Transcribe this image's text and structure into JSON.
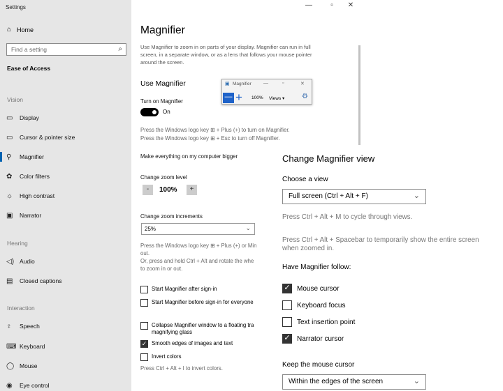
{
  "window": {
    "title": "Settings"
  },
  "sidebar": {
    "home": "Home",
    "search_placeholder": "Find a setting",
    "category": "Ease of Access",
    "sections": {
      "vision": "Vision",
      "hearing": "Hearing",
      "interaction": "Interaction"
    },
    "items": [
      {
        "label": "Display",
        "icon": "monitor-icon"
      },
      {
        "label": "Cursor & pointer size",
        "icon": "pointer-icon"
      },
      {
        "label": "Magnifier",
        "icon": "magnifier-icon"
      },
      {
        "label": "Color filters",
        "icon": "color-filter-icon"
      },
      {
        "label": "High contrast",
        "icon": "contrast-icon"
      },
      {
        "label": "Narrator",
        "icon": "narrator-icon"
      },
      {
        "label": "Audio",
        "icon": "speaker-icon"
      },
      {
        "label": "Closed captions",
        "icon": "captions-icon"
      },
      {
        "label": "Speech",
        "icon": "microphone-icon"
      },
      {
        "label": "Keyboard",
        "icon": "keyboard-icon"
      },
      {
        "label": "Mouse",
        "icon": "mouse-icon"
      },
      {
        "label": "Eye control",
        "icon": "eye-icon"
      }
    ],
    "active_item": "Magnifier"
  },
  "main": {
    "title": "Magnifier",
    "description": "Use Magnifier to zoom in on parts of your display. Magnifier can run in full screen, in a separate window, or as a lens that follows your mouse pointer around the screen.",
    "use_heading": "Use Magnifier",
    "turn_on_label": "Turn on Magnifier",
    "toggle_state": "On",
    "shortcut_on": "Press the Windows logo key ⊞ + Plus (+) to turn on Magnifier.",
    "shortcut_off": "Press the Windows logo key ⊞ + Esc to turn off Magnifier.",
    "bigger_label": "Make everything on my computer bigger",
    "zoom_level_label": "Change zoom level",
    "zoom_minus": "-",
    "zoom_value": "100%",
    "zoom_plus": "+",
    "increments_label": "Change zoom increments",
    "increments_value": "25%",
    "zoom_hint_1": "Press the Windows logo key ⊞ + Plus (+) or Min",
    "zoom_hint_2": "out.",
    "zoom_hint_3": "Or, press and hold Ctrl + Alt and rotate the whe",
    "zoom_hint_4": "to zoom in or out.",
    "checkboxes": [
      {
        "label": "Start Magnifier after sign-in",
        "checked": false
      },
      {
        "label": "Start Magnifier before sign-in for everyone",
        "checked": false
      },
      {
        "label": "Collapse Magnifier window to a floating tra",
        "label2": "magnifying glass",
        "checked": false
      },
      {
        "label": "Smooth edges of images and text",
        "checked": true
      },
      {
        "label": "Invert colors",
        "checked": false
      }
    ],
    "invert_hint": "Press Ctrl + Alt + I to invert colors.",
    "mag_toolbar": {
      "title": "Magnifier",
      "zoom": "100%",
      "views": "Views ▾"
    }
  },
  "overlay": {
    "title": "Change Magnifier view",
    "choose_view_label": "Choose a view",
    "view_value": "Full screen (Ctrl + Alt + F)",
    "cycle_hint": "Press Ctrl + Alt + M to cycle through views.",
    "spacebar_hint_1": "Press Ctrl + Alt + Spacebar to temporarily show the entire screen",
    "spacebar_hint_2": "when zoomed in.",
    "follow_label": "Have Magnifier follow:",
    "follow_options": [
      {
        "label": "Mouse cursor",
        "checked": true
      },
      {
        "label": "Keyboard focus",
        "checked": false
      },
      {
        "label": "Text insertion point",
        "checked": false
      },
      {
        "label": "Narrator cursor",
        "checked": true
      }
    ],
    "keep_label": "Keep the mouse cursor",
    "keep_value": "Within the edges of the screen"
  }
}
